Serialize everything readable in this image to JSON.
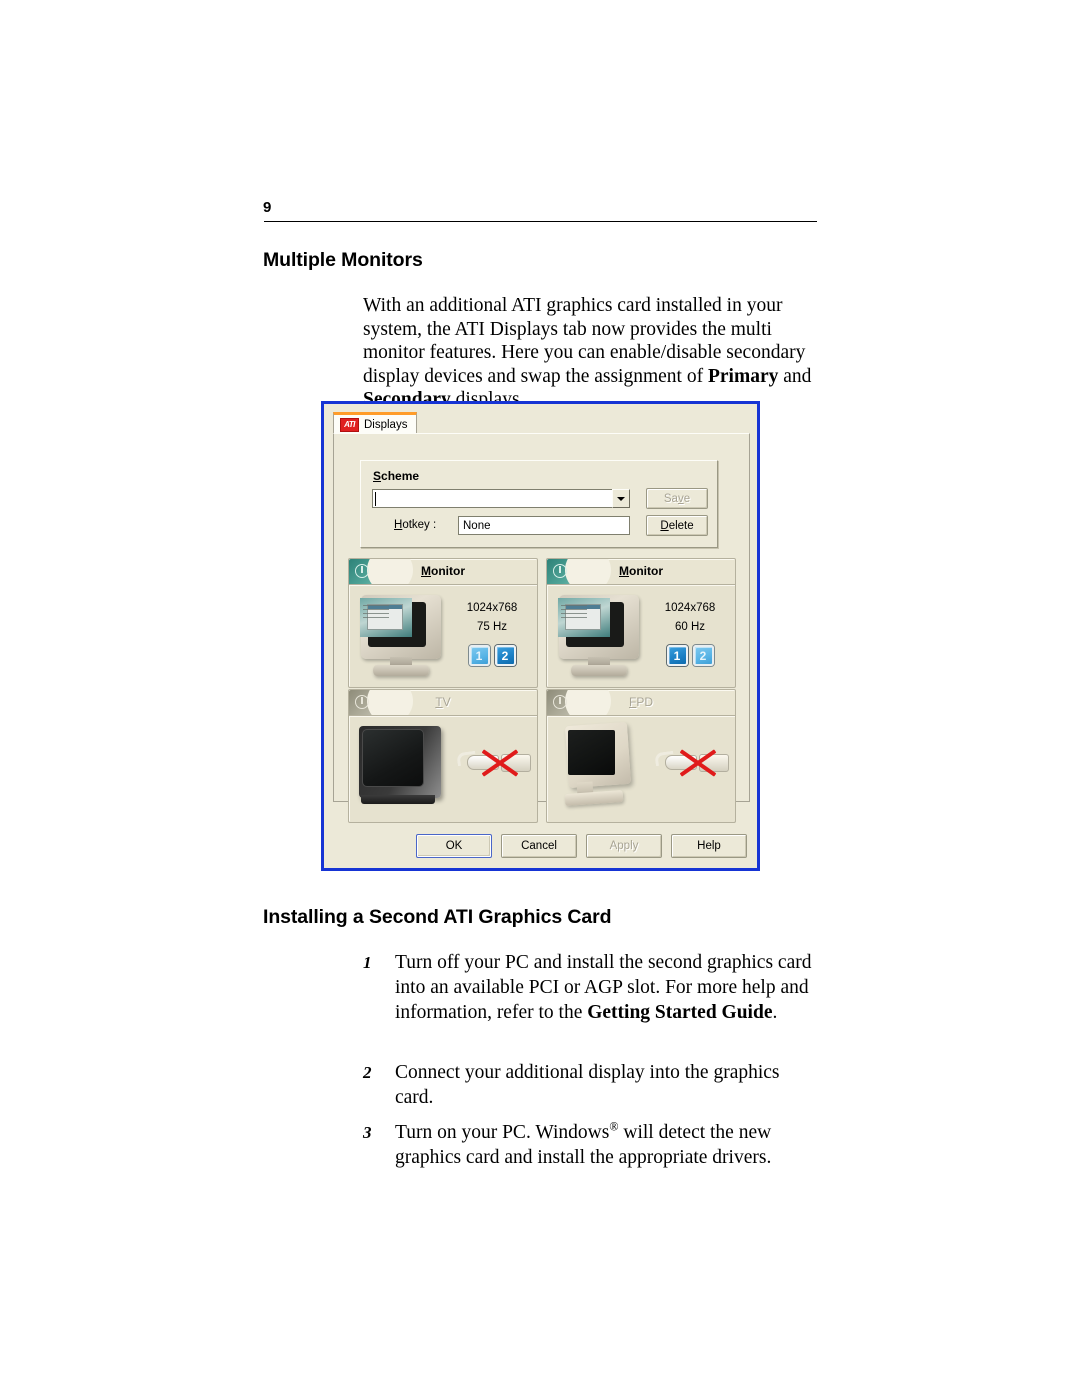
{
  "page": {
    "number": "9"
  },
  "sections": {
    "multiple_monitors": {
      "heading": "Multiple Monitors",
      "paragraph_part1": "With an additional ATI graphics card installed in your system, the ATI Displays tab now provides the multi monitor features. Here you can enable/disable secondary display devices and swap the assignment of ",
      "paragraph_bold1": "Primary",
      "paragraph_mid": " and ",
      "paragraph_bold2": "Secondary",
      "paragraph_end": " displays."
    },
    "installing_card": {
      "heading": "Installing a Second ATI Graphics Card",
      "steps": [
        {
          "number": "1",
          "text_part1": "Turn off your PC and install the second graphics card into an available PCI or AGP slot. For more help and information, refer to the ",
          "bold": "Getting Started Guide",
          "text_end": "."
        },
        {
          "number": "2",
          "text_part1": "Connect your additional display into the graphics card.",
          "bold": "",
          "text_end": ""
        },
        {
          "number": "3",
          "text_part1": "Turn on your PC. Windows",
          "superscript": "®",
          "text_end": " will detect the new graphics card and install the appropriate drivers."
        }
      ]
    }
  },
  "dialog": {
    "tab": {
      "logo_text": "ATI",
      "label": "Displays"
    },
    "scheme": {
      "group_label_underlined": "S",
      "group_label_rest": "cheme",
      "combo_value": "",
      "hotkey_label_underlined": "H",
      "hotkey_label_rest": "otkey :",
      "hotkey_value": "None",
      "save_underlined": "Sa",
      "save_accel": "v",
      "save_rest": "e",
      "delete_underlined": "D",
      "delete_rest": "elete"
    },
    "devices": [
      {
        "id": "monitor-1",
        "title_accel": "M",
        "title_rest": "onitor",
        "enabled": true,
        "resolution": "1024x768",
        "refresh": "75 Hz",
        "badges": [
          {
            "label": "1",
            "state": "light"
          },
          {
            "label": "2",
            "state": "dark"
          }
        ]
      },
      {
        "id": "monitor-2",
        "title_accel": "M",
        "title_rest": "onitor",
        "enabled": true,
        "resolution": "1024x768",
        "refresh": "60 Hz",
        "badges": [
          {
            "label": "1",
            "state": "dark"
          },
          {
            "label": "2",
            "state": "light"
          }
        ]
      },
      {
        "id": "tv",
        "title_accel": "T",
        "title_rest": "V",
        "enabled": false,
        "status": "disconnected"
      },
      {
        "id": "fpd",
        "title_accel": "F",
        "title_rest": "PD",
        "enabled": false,
        "status": "disconnected"
      }
    ],
    "buttons": {
      "ok": "OK",
      "cancel": "Cancel",
      "apply": "Apply",
      "help": "Help",
      "apply_disabled": true,
      "ok_is_default": true
    },
    "colors": {
      "border": "#1634d4",
      "face": "#ece9d8",
      "tab_accent": "#ff9c29",
      "ati_red": "#e02020",
      "power_teal": "#2d8278",
      "badge_light": "#58b4e6",
      "badge_dark": "#1b7fc4",
      "x_red": "#e01b1b"
    }
  }
}
